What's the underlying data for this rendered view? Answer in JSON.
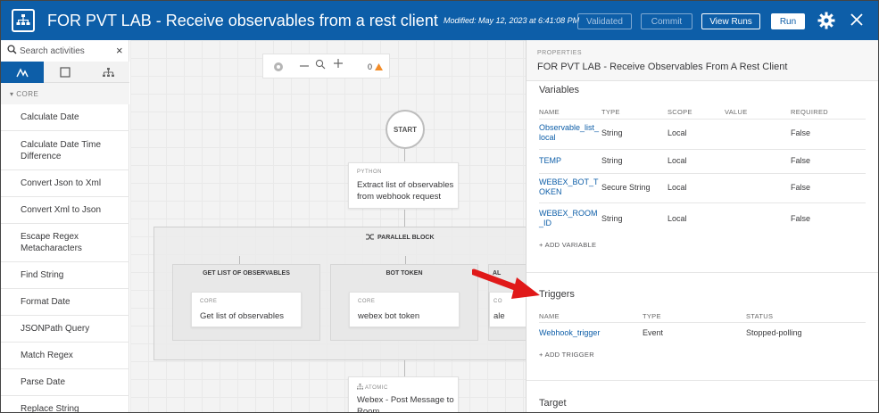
{
  "header": {
    "title": "FOR PVT LAB - Receive observables from a rest client",
    "modified": "Modified: May 12, 2023 at 6:41:08 PM",
    "validated_label": "Validated",
    "commit_label": "Commit",
    "view_runs_label": "View Runs",
    "run_label": "Run",
    "colors": {
      "header_bg": "#0d5ea8"
    }
  },
  "sidebar": {
    "search_placeholder": "Search activities",
    "section": "CORE",
    "activities": [
      "Calculate Date",
      "Calculate Date Time Difference",
      "Convert Json to Xml",
      "Convert Xml to Json",
      "Escape Regex Metacharacters",
      "Find String",
      "Format Date",
      "JSONPath Query",
      "Match Regex",
      "Parse Date",
      "Replace String"
    ]
  },
  "canvas": {
    "warning_count": "0",
    "start_label": "START",
    "python_node": {
      "kind": "PYTHON",
      "title": "Extract list of observables from webhook request"
    },
    "parallel_label": "PARALLEL BLOCK",
    "branches": [
      {
        "label": "GET LIST OF OBSERVABLES",
        "kind": "CORE",
        "title": "Get list of observables"
      },
      {
        "label": "BOT TOKEN",
        "kind": "CORE",
        "title": "webex bot token"
      },
      {
        "label": "AL",
        "kind": "CO",
        "title": "ale"
      }
    ],
    "atomic_node": {
      "kind": "ATOMIC",
      "title": "Webex - Post Message to Room"
    }
  },
  "properties": {
    "label": "PROPERTIES",
    "title": "FOR PVT LAB - Receive Observables From A Rest Client",
    "variables": {
      "heading": "Variables",
      "columns": [
        "NAME",
        "TYPE",
        "SCOPE",
        "VALUE",
        "REQUIRED"
      ],
      "rows": [
        {
          "name": "Observable_list_local",
          "type": "String",
          "scope": "Local",
          "value": "",
          "required": "False"
        },
        {
          "name": "TEMP",
          "type": "String",
          "scope": "Local",
          "value": "",
          "required": "False"
        },
        {
          "name": "WEBEX_BOT_TOKEN",
          "type": "Secure String",
          "scope": "Local",
          "value": "",
          "required": "False"
        },
        {
          "name": "WEBEX_ROOM_ID",
          "type": "String",
          "scope": "Local",
          "value": "",
          "required": "False"
        }
      ],
      "add_label": "ADD VARIABLE"
    },
    "triggers": {
      "heading": "Triggers",
      "columns": [
        "NAME",
        "TYPE",
        "STATUS"
      ],
      "rows": [
        {
          "name": "Webhook_trigger",
          "type": "Event",
          "status": "Stopped-polling"
        }
      ],
      "add_label": "ADD TRIGGER"
    },
    "target_heading": "Target"
  }
}
